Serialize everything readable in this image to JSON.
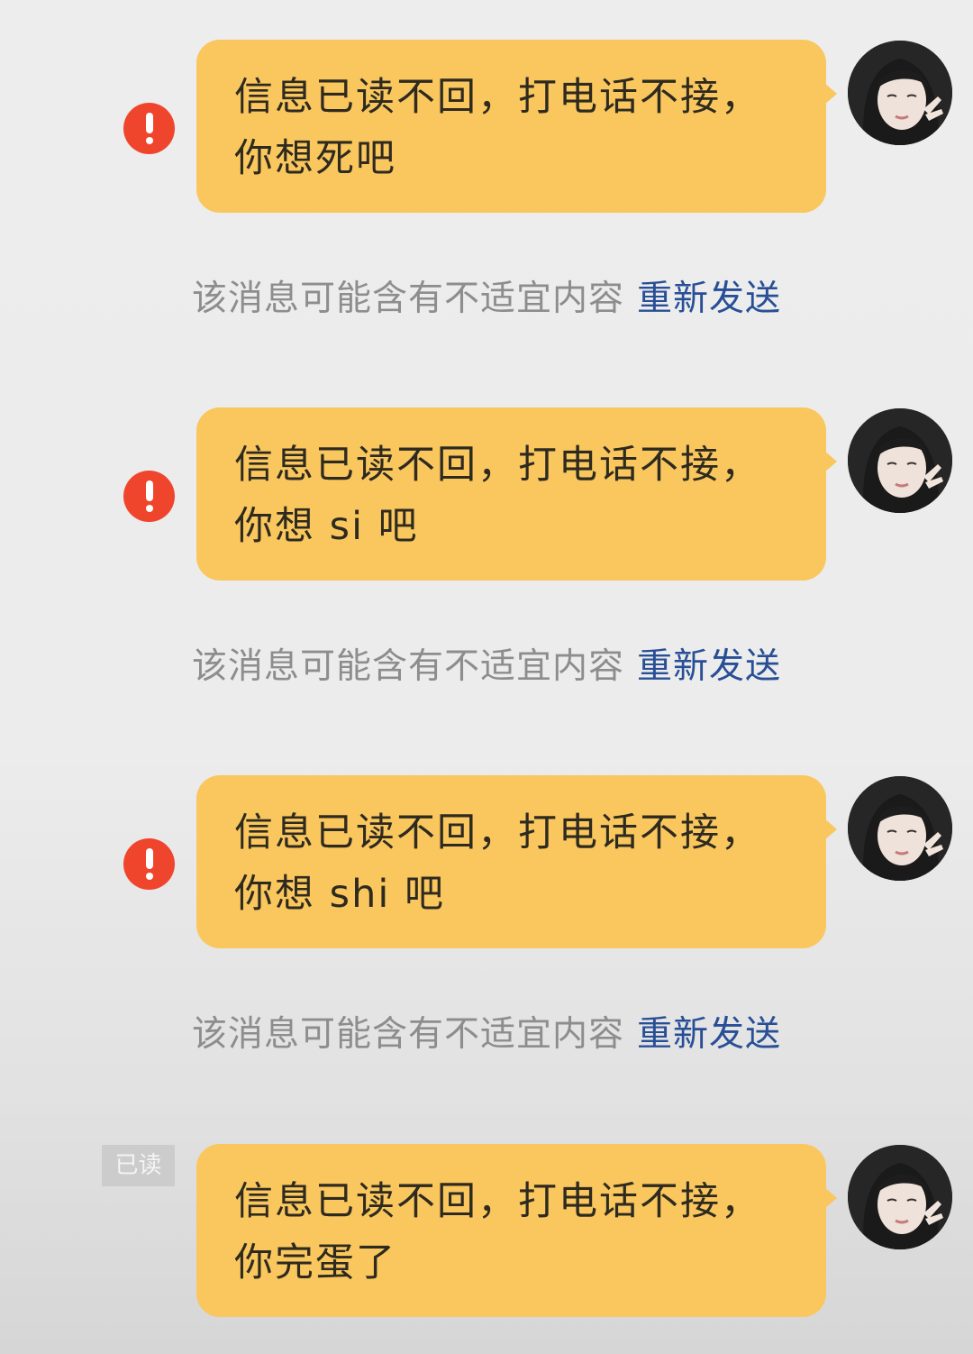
{
  "colors": {
    "bubble": "#f9c75d",
    "error_icon": "#f0452d",
    "resend_link": "#284f96",
    "notice_text": "#8d8d8d"
  },
  "messages": [
    {
      "text": "信息已读不回，打电话不接，\n你想死吧",
      "status": "failed",
      "status_icon": "exclamation-icon",
      "notice": "该消息可能含有不适宜内容",
      "action": "重新发送"
    },
    {
      "text": "信息已读不回，打电话不接，\n你想 si 吧",
      "status": "failed",
      "status_icon": "exclamation-icon",
      "notice": "该消息可能含有不适宜内容",
      "action": "重新发送"
    },
    {
      "text": "信息已读不回，打电话不接，\n你想 shi 吧",
      "status": "failed",
      "status_icon": "exclamation-icon",
      "notice": "该消息可能含有不适宜内容",
      "action": "重新发送"
    },
    {
      "text": "信息已读不回，打电话不接，\n你完蛋了",
      "status": "read",
      "status_label": "已读"
    }
  ]
}
